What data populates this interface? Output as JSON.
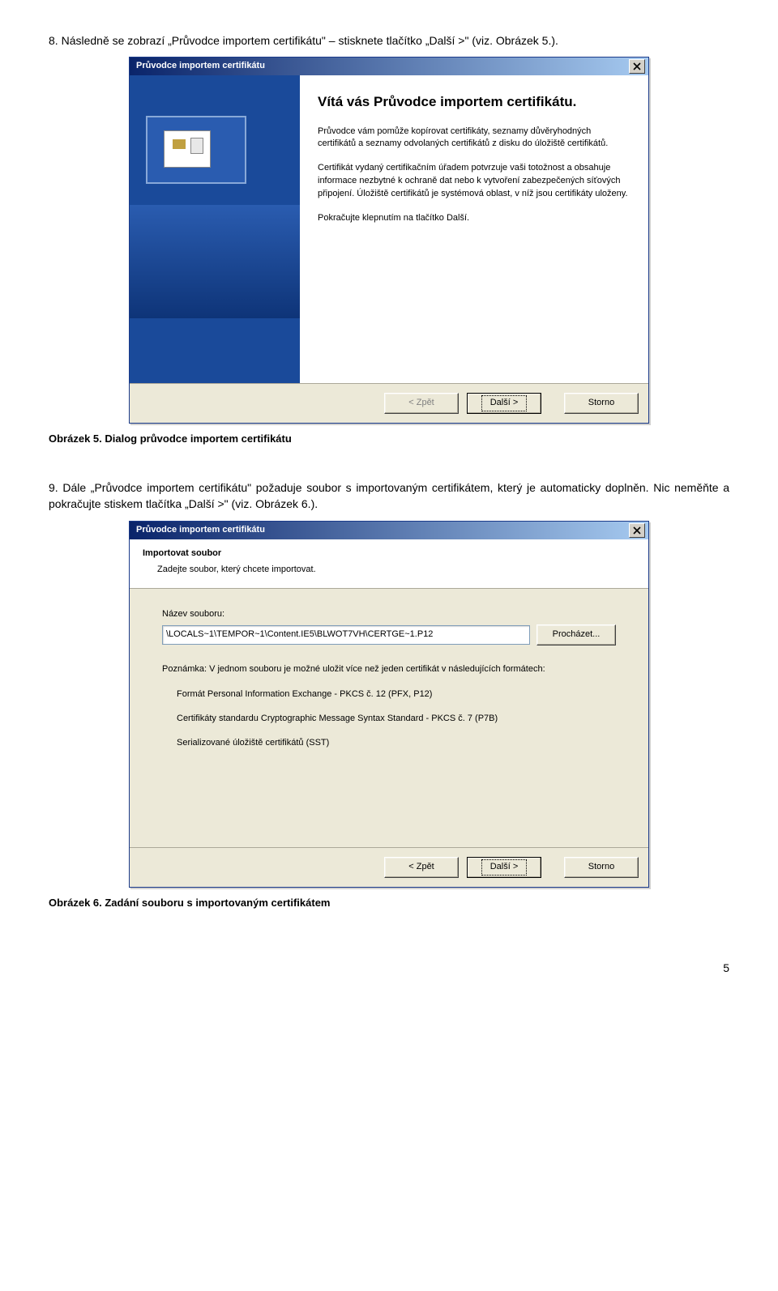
{
  "step8": {
    "number": "8.",
    "text": "Následně se zobrazí „Průvodce importem certifikátu\" – stisknete tlačítko „Další >\" (viz. Obrázek 5.)."
  },
  "dialog1": {
    "title": "Průvodce importem certifikátu",
    "heading": "Vítá vás Průvodce importem certifikátu.",
    "p1": "Průvodce vám pomůže kopírovat certifikáty, seznamy důvěryhodných certifikátů a seznamy odvolaných certifikátů z disku do úložiště certifikátů.",
    "p2": "Certifikát vydaný certifikačním úřadem potvrzuje vaši totožnost a obsahuje informace nezbytné k ochraně dat nebo k vytvoření zabezpečených síťových připojení. Úložiště certifikátů je systémová oblast, v níž jsou certifikáty uloženy.",
    "p3": "Pokračujte klepnutím na tlačítko Další.",
    "back": "< Zpět",
    "next": "Další >",
    "cancel": "Storno"
  },
  "caption1": "Obrázek 5. Dialog průvodce importem certifikátu",
  "step9": {
    "number": "9.",
    "text": "Dále „Průvodce importem certifikátu\" požaduje soubor s importovaným certifikátem, který je automaticky doplněn. Nic neměňte a pokračujte stiskem tlačítka „Další >\" (viz. Obrázek 6.)."
  },
  "dialog2": {
    "title": "Průvodce importem certifikátu",
    "header_title": "Importovat soubor",
    "header_sub": "Zadejte soubor, který chcete importovat.",
    "filename_label": "Název souboru:",
    "filename_value": "\\LOCALS~1\\TEMPOR~1\\Content.IE5\\BLWOT7VH\\CERTGE~1.P12",
    "browse": "Procházet...",
    "note": "Poznámka: V jednom souboru je možné uložit více než jeden certifikát v následujících formátech:",
    "fmt1": "Formát Personal Information Exchange - PKCS č. 12 (PFX, P12)",
    "fmt2": "Certifikáty standardu Cryptographic Message Syntax Standard - PKCS č. 7 (P7B)",
    "fmt3": "Serializované úložiště certifikátů (SST)",
    "back": "< Zpět",
    "next": "Další >",
    "cancel": "Storno"
  },
  "caption2": "Obrázek 6. Zadání souboru s importovaným certifikátem",
  "page_number": "5"
}
